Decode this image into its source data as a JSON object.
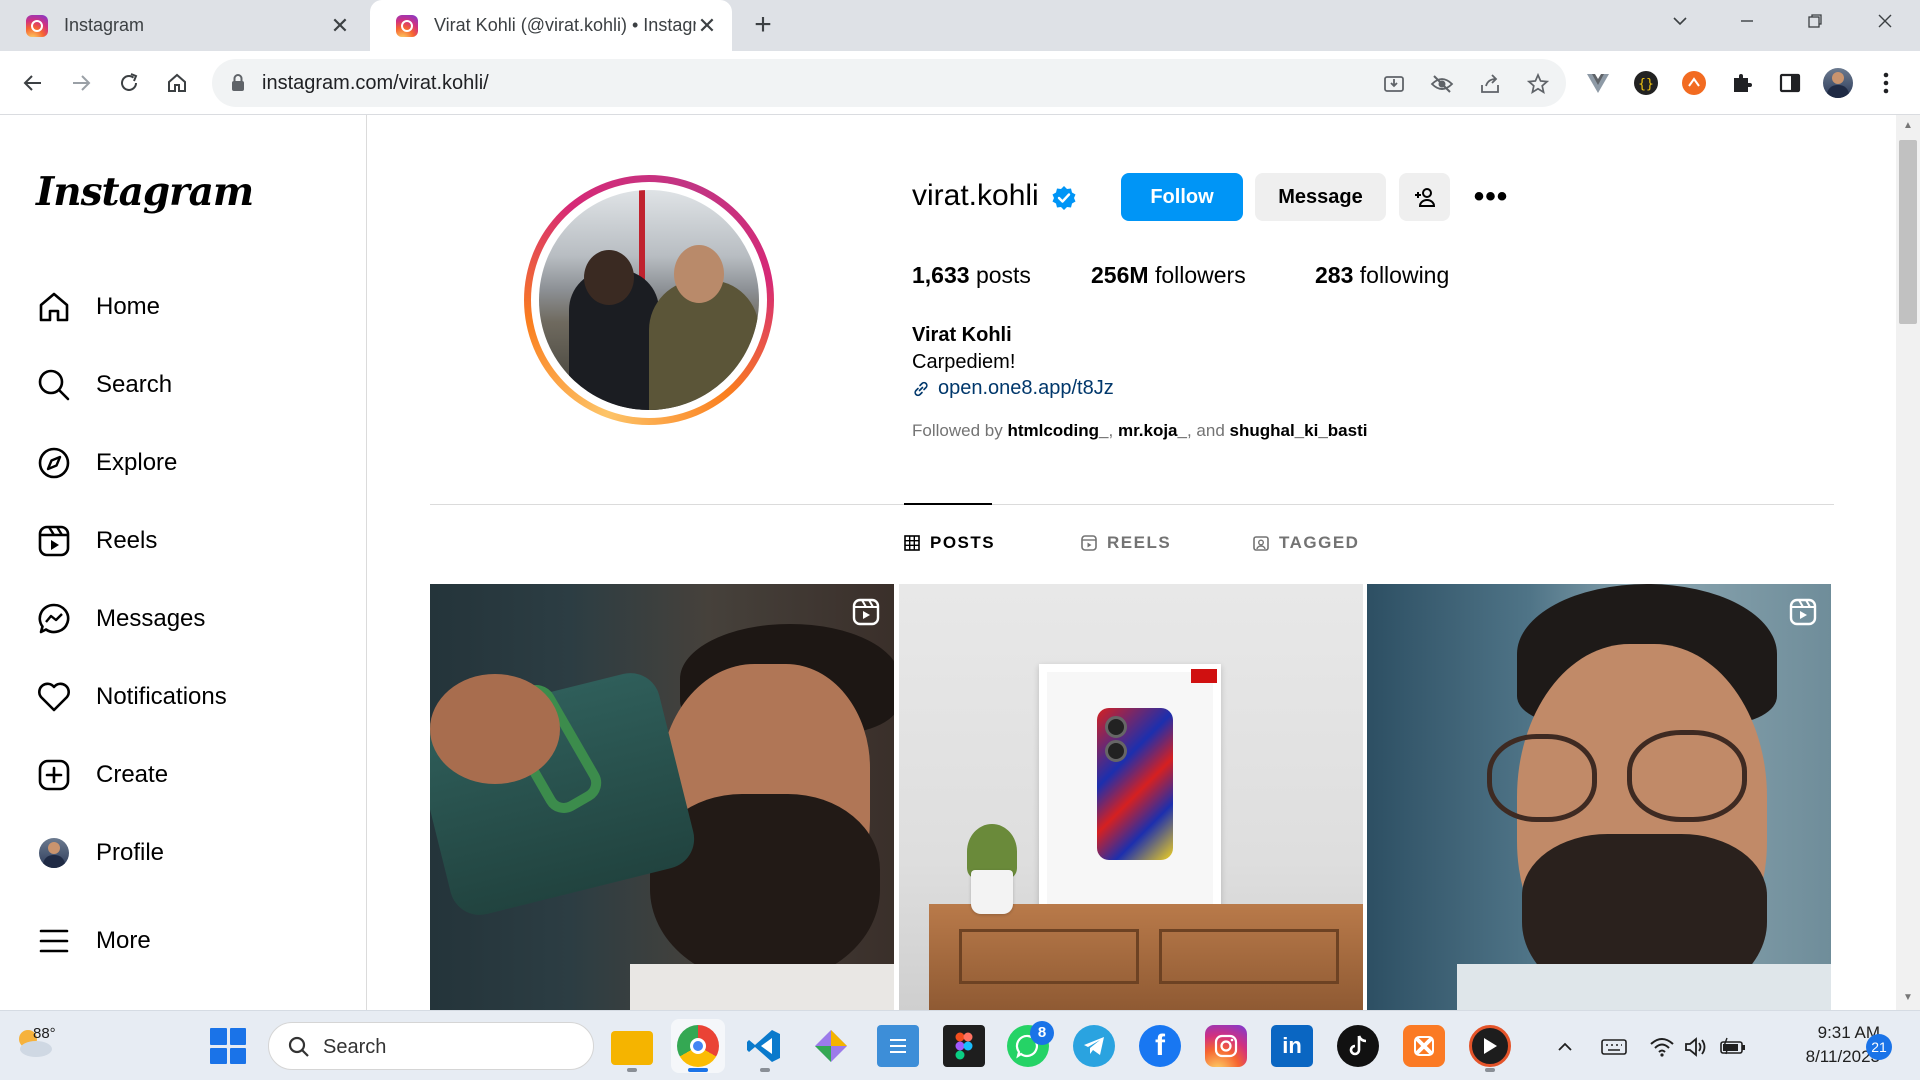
{
  "browser": {
    "tabs": [
      {
        "title": "Instagram",
        "close": "✕"
      },
      {
        "title": "Virat Kohli (@virat.kohli) • Instagram",
        "close": "✕"
      }
    ],
    "new_tab": "+",
    "url": "instagram.com/virat.kohli/"
  },
  "sidebar": {
    "logo": "Instagram",
    "items": [
      {
        "label": "Home",
        "icon": "home-icon"
      },
      {
        "label": "Search",
        "icon": "search-icon"
      },
      {
        "label": "Explore",
        "icon": "compass-icon"
      },
      {
        "label": "Reels",
        "icon": "reels-icon"
      },
      {
        "label": "Messages",
        "icon": "messenger-icon"
      },
      {
        "label": "Notifications",
        "icon": "heart-icon"
      },
      {
        "label": "Create",
        "icon": "plus-square-icon"
      },
      {
        "label": "Profile",
        "icon": "avatar"
      },
      {
        "label": "More",
        "icon": "menu-icon"
      }
    ]
  },
  "profile": {
    "username": "virat.kohli",
    "verified": true,
    "buttons": {
      "follow": "Follow",
      "message": "Message",
      "more": "•••"
    },
    "stats": {
      "posts_count": "1,633",
      "posts_label": "posts",
      "followers_count": "256M",
      "followers_label": "followers",
      "following_count": "283",
      "following_label": "following"
    },
    "full_name": "Virat Kohli",
    "bio": "Carpediem!",
    "link": "open.one8.app/t8Jz",
    "followed_by": {
      "prefix": "Followed by",
      "user1": "htmlcoding_",
      "user2": "mr.koja_",
      "joiner": ", and",
      "user3": "shughal_ki_basti"
    },
    "tabs": [
      {
        "label": "POSTS",
        "active": true
      },
      {
        "label": "REELS",
        "active": false
      },
      {
        "label": "TAGGED",
        "active": false
      }
    ]
  },
  "colors": {
    "follow_button": "#0095f6",
    "verified_badge": "#0095f6",
    "link": "#00376b"
  },
  "taskbar": {
    "temperature": "88°",
    "search_label": "Search",
    "whatsapp_badge": "8",
    "time": "9:31 AM",
    "date": "8/11/2023",
    "notification_count": "21"
  }
}
